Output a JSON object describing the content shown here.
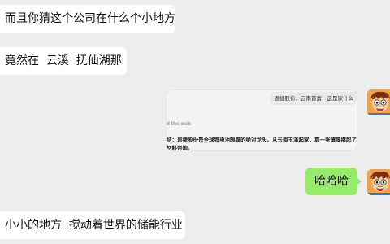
{
  "messages": [
    {
      "side": "left",
      "text": "而且你猜这个公司在什么个小地方"
    },
    {
      "side": "left",
      "text": "竟然在  云溪  抚仙湖那"
    },
    {
      "side": "right",
      "card": {
        "query": "恩捷股份，云南首富，这是家什么",
        "source_label": "d the web",
        "answer_lines": [
          "结：恩捷股份是全球锂电池隔膜的绝对龙头。从云南玉溪起家，靠一张薄膜撑起了",
          "材料帝国。"
        ]
      }
    },
    {
      "side": "right",
      "text": "哈哈哈"
    },
    {
      "side": "left",
      "text": "小小的地方  搅动着世界的储能行业"
    }
  ],
  "colors": {
    "background": "#ededed",
    "left_bubble": "#ffffff",
    "right_bubble": "#95ec69"
  },
  "avatar_icon": "cartoon-face-avatar"
}
